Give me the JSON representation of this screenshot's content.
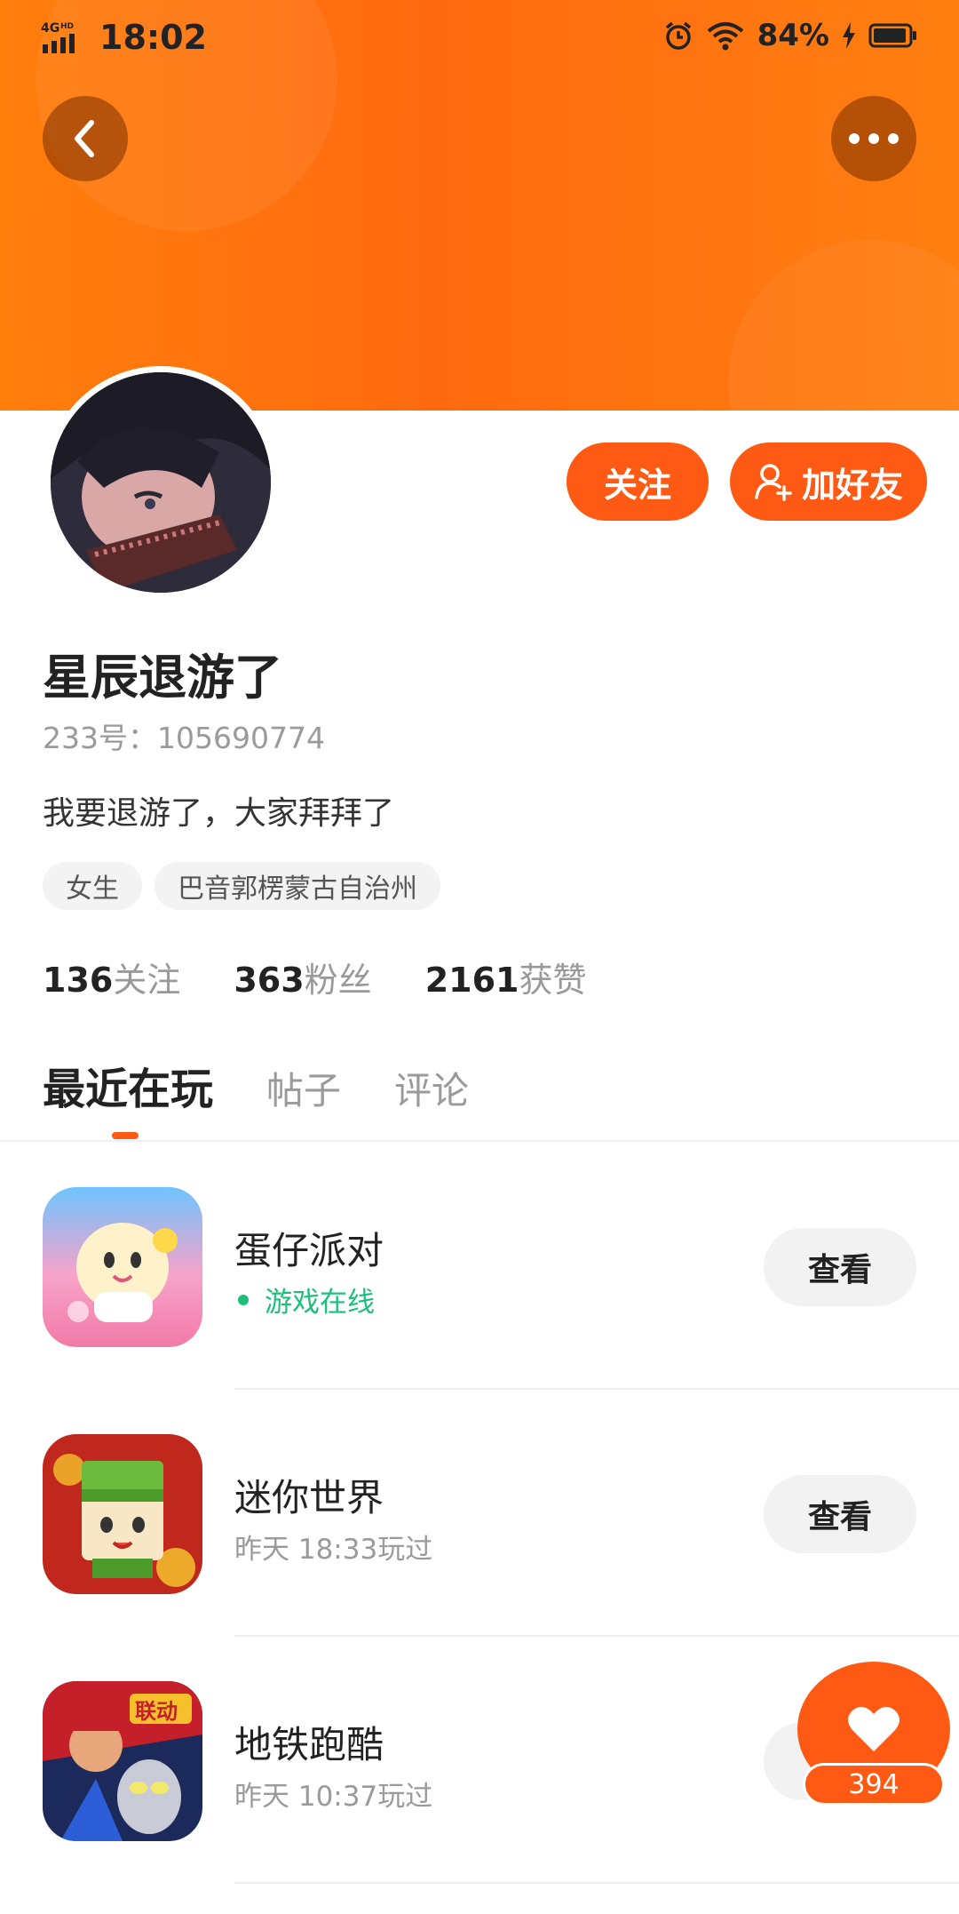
{
  "status_bar": {
    "network": "4G HD",
    "time": "18:02",
    "battery_percent": "84%"
  },
  "profile": {
    "nickname": "星辰退游了",
    "uid": "233号：105690774",
    "bio": "我要退游了，大家拜拜了",
    "tags": [
      "女生",
      "巴音郭楞蒙古自治州"
    ],
    "stats": {
      "following_count": "136",
      "following_label": "关注",
      "fans_count": "363",
      "fans_label": "粉丝",
      "likes_count": "2161",
      "likes_label": "获赞"
    }
  },
  "actions": {
    "follow_label": "关注",
    "add_friend_label": "加好友"
  },
  "tabs": [
    {
      "label": "最近在玩",
      "active": true
    },
    {
      "label": "帖子",
      "active": false
    },
    {
      "label": "评论",
      "active": false
    }
  ],
  "games": [
    {
      "title": "蛋仔派对",
      "subtitle": "游戏在线",
      "online": true,
      "button": "查看"
    },
    {
      "title": "迷你世界",
      "subtitle": "昨天 18:33玩过",
      "online": false,
      "button": "查看"
    },
    {
      "title": "地铁跑酷",
      "subtitle": "昨天 10:37玩过",
      "online": false,
      "button": "查看"
    }
  ],
  "like_fab": {
    "count": "394"
  },
  "colors": {
    "brand_orange": "#ff5a14",
    "header_orange": "#ff7a10",
    "online_green": "#1cc07a"
  }
}
